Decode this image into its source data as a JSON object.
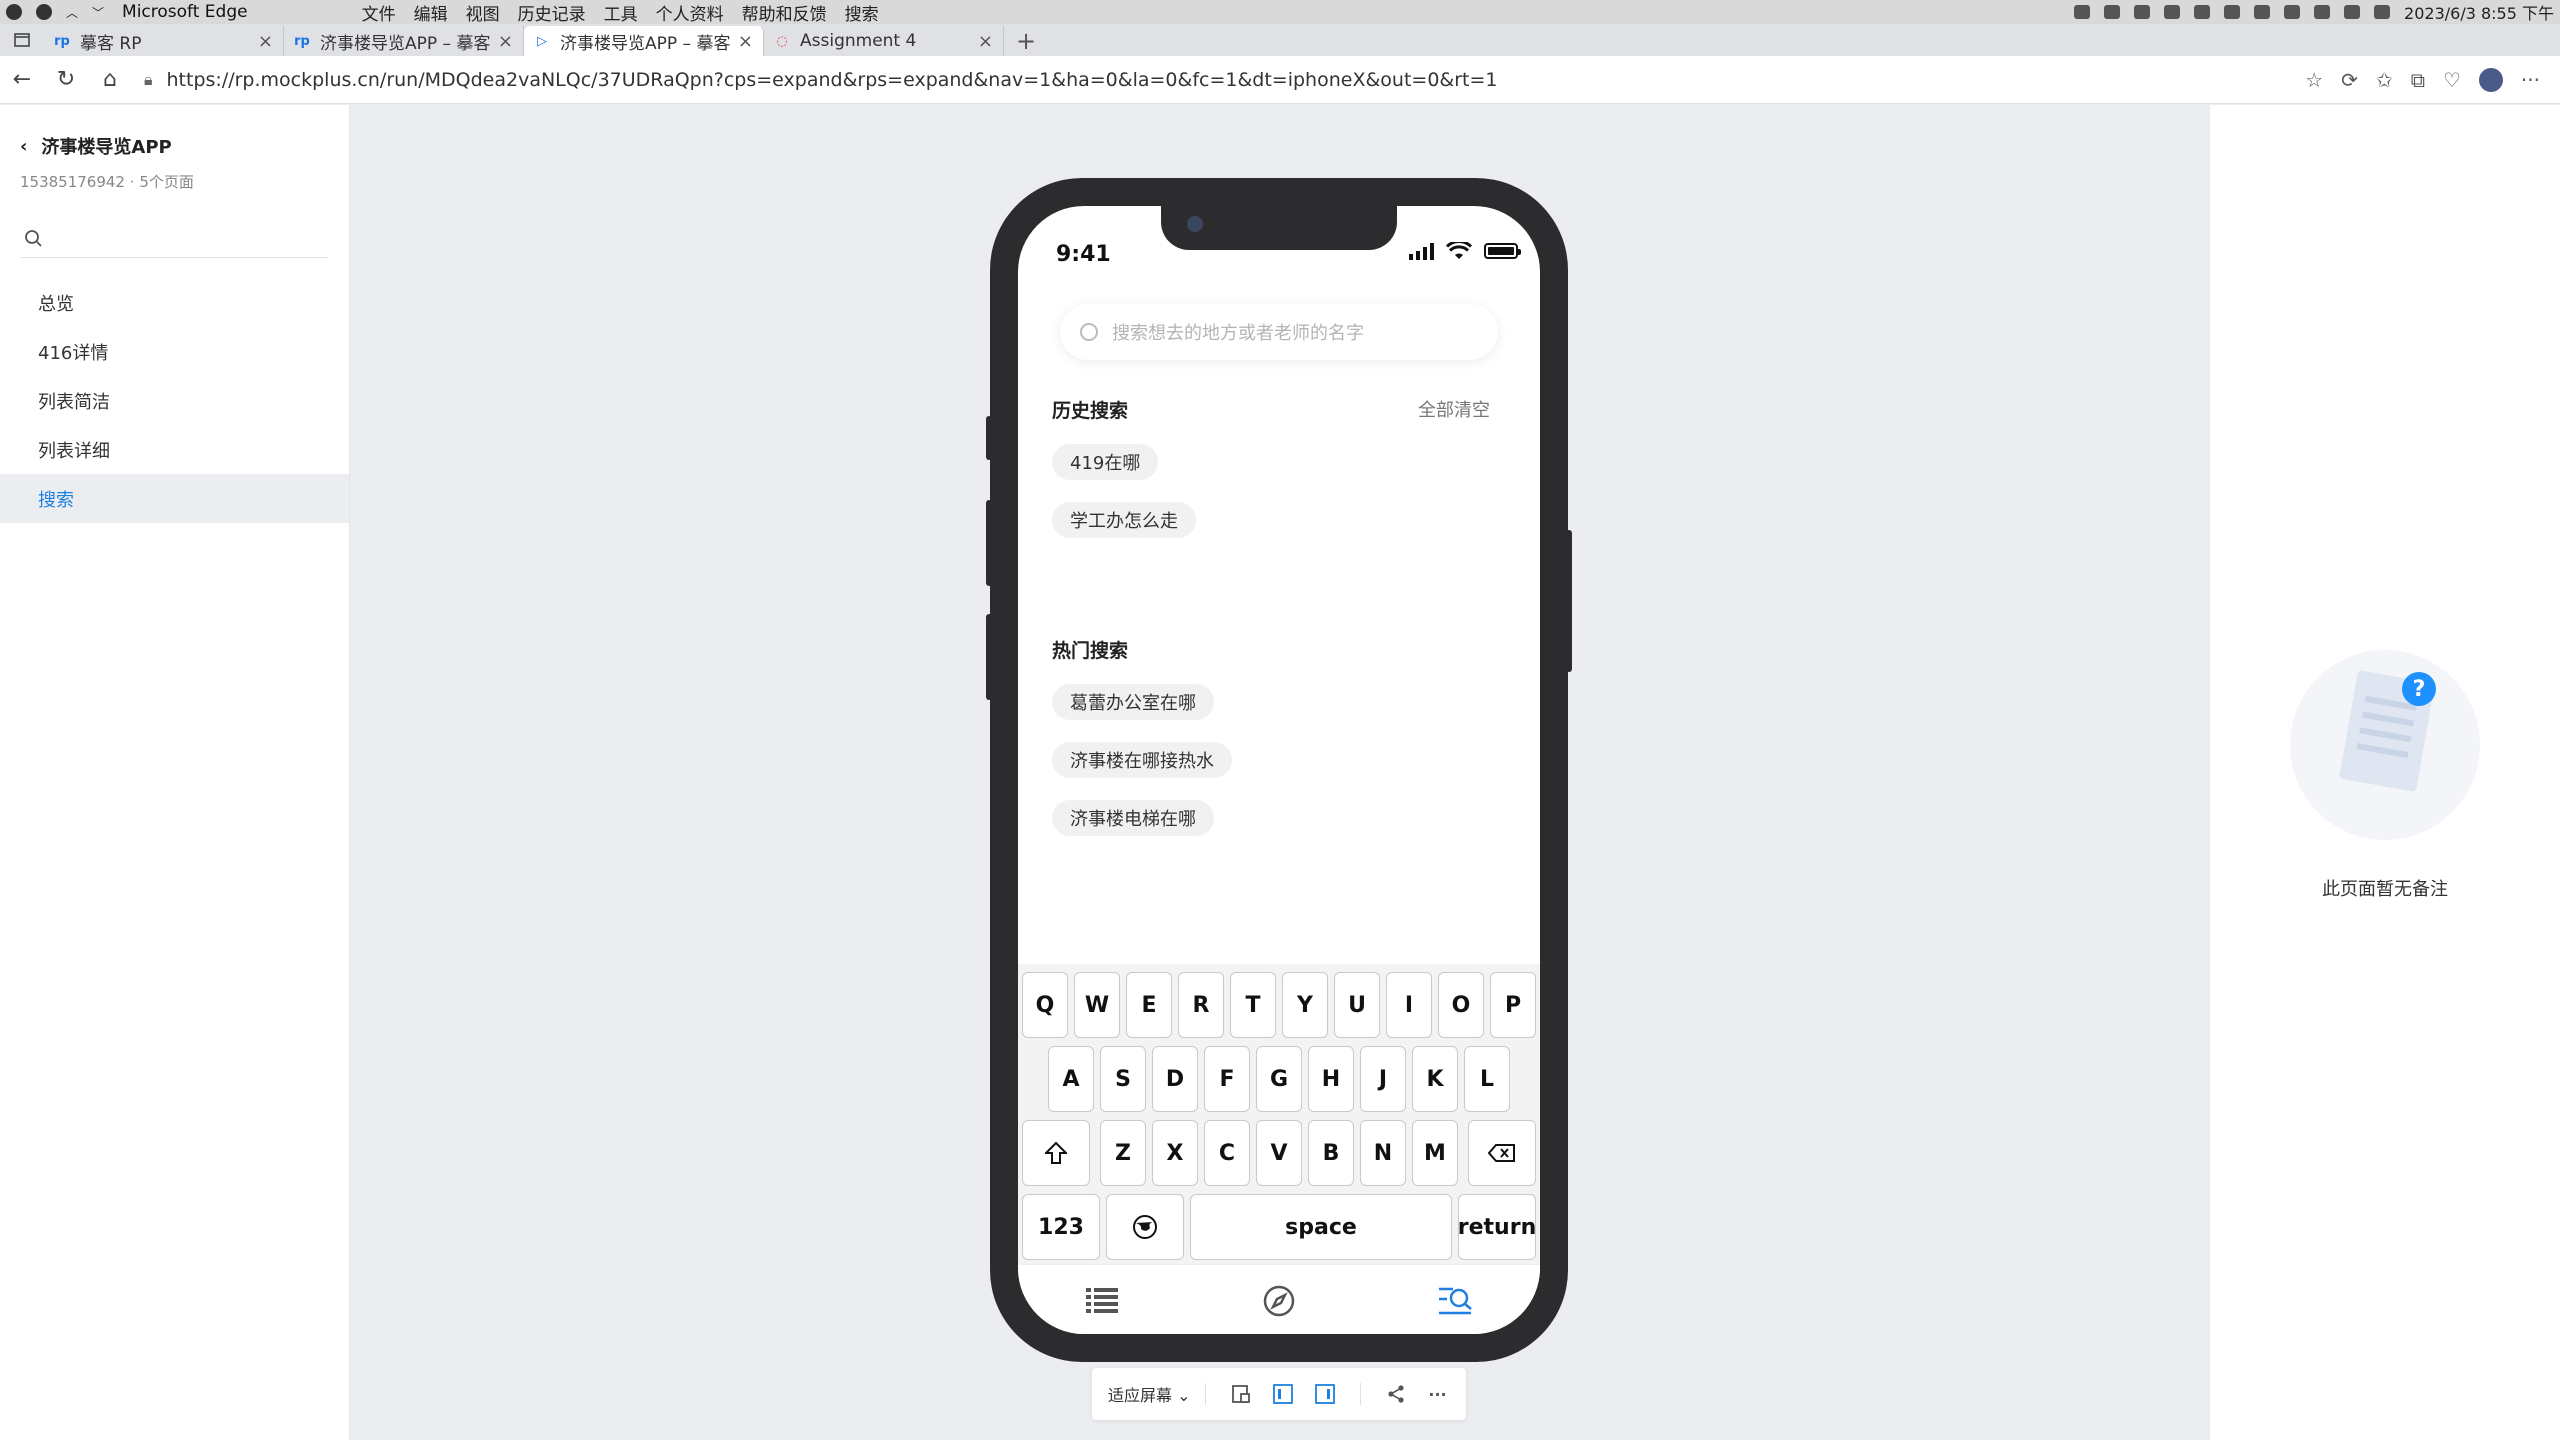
{
  "menubar": {
    "app_name": "Microsoft Edge",
    "menus": [
      "文件",
      "编辑",
      "视图",
      "历史记录",
      "工具",
      "个人资料",
      "帮助和反馈",
      "搜索"
    ],
    "datetime": "2023/6/3  8:55 下午"
  },
  "tabs": [
    {
      "title": "摹客 RP",
      "favicon": "rp"
    },
    {
      "title": "济事楼导览APP – 摹客",
      "favicon": "rp"
    },
    {
      "title": "济事楼导览APP – 摹客",
      "favicon": "play"
    },
    {
      "title": "Assignment 4",
      "favicon": "circle"
    }
  ],
  "address": {
    "url": "https://rp.mockplus.cn/run/MDQdea2vaNLQc/37UDRaQpn?cps=expand&rps=expand&nav=1&ha=0&la=0&fc=1&dt=iphoneX&out=0&rt=1"
  },
  "sidebar": {
    "project_title": "济事楼导览APP",
    "phone": "15385176942",
    "page_count": "5个页面",
    "items": [
      {
        "label": "总览"
      },
      {
        "label": "416详情"
      },
      {
        "label": "列表简洁"
      },
      {
        "label": "列表详细"
      },
      {
        "label": "搜索"
      }
    ]
  },
  "phone": {
    "time": "9:41",
    "search_placeholder": "搜索想去的地方或者老师的名字",
    "history_title": "历史搜索",
    "clear_all": "全部清空",
    "history": [
      "419在哪",
      "学工办怎么走"
    ],
    "hot_title": "热门搜索",
    "hot": [
      "葛蕾办公室在哪",
      "济事楼在哪接热水",
      "济事楼电梯在哪"
    ],
    "keyboard": {
      "row1": [
        "Q",
        "W",
        "E",
        "R",
        "T",
        "Y",
        "U",
        "I",
        "O",
        "P"
      ],
      "row2": [
        "A",
        "S",
        "D",
        "F",
        "G",
        "H",
        "J",
        "K",
        "L"
      ],
      "row3": [
        "Z",
        "X",
        "C",
        "V",
        "B",
        "N",
        "M"
      ],
      "num": "123",
      "space": "space",
      "return": "return"
    },
    "accent": "#1e7fe0"
  },
  "notes": {
    "empty_text": "此页面暂无备注"
  },
  "toolbar": {
    "fit_label": "适应屏幕"
  }
}
